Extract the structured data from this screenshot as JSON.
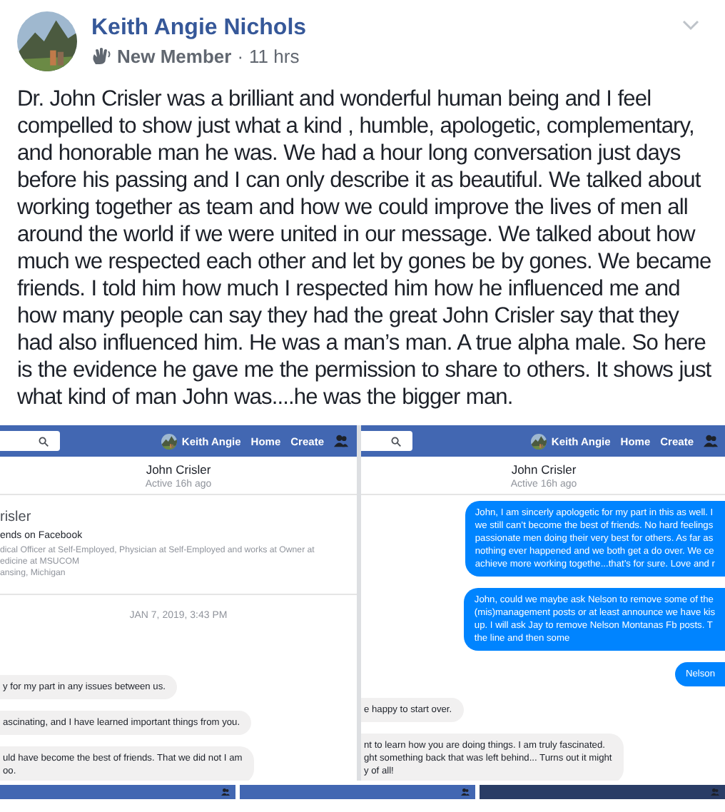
{
  "post": {
    "author": "Keith Angie Nichols",
    "badge": "New Member",
    "separator": "·",
    "time": "11 hrs",
    "body": "Dr. John Crisler was a brilliant and wonderful human being and I feel compelled to show just what a kind , humble, apologetic, complementary, and honorable man he was. We had a hour long conversation just days before his passing and I can only describe it as beautiful. We talked about working together as team and how we could improve the lives of men all around the world if we were united in our message. We talked about how much we respected each other and let by gones be by gones. We became friends. I told him how much I respected him how he influenced me and how many people can say they had the great John Crisler say that they had also influenced him. He was a man’s man. A true alpha male. So here is the evidence he gave me the permission to share to others. It shows just what kind of man John was....he was the bigger man."
  },
  "screenshots": [
    {
      "nav": {
        "user": "Keith Angie",
        "links": [
          "Home",
          "Create"
        ]
      },
      "chat": {
        "name": "John Crisler",
        "status": "Active 16h ago"
      },
      "items": [
        {
          "kind": "profile",
          "name": "risler",
          "subtitle": "ends on Facebook",
          "details": [
            "dical Officer at Self-Employed, Physician at Self-Employed and works at Owner at",
            "edicine at MSUCOM",
            "ansing, Michigan"
          ]
        },
        {
          "kind": "date",
          "text": "JAN 7, 2019, 3:43 PM"
        },
        {
          "kind": "spacer"
        },
        {
          "kind": "incoming",
          "lines": [
            "y for my part in any issues between us."
          ]
        },
        {
          "kind": "incoming",
          "lines": [
            "ascinating, and I have learned important things from you."
          ]
        },
        {
          "kind": "incoming",
          "lines": [
            "uld have become the best of friends. That we did not I am",
            "oo."
          ]
        }
      ]
    },
    {
      "nav": {
        "user": "Keith Angie",
        "links": [
          "Home",
          "Create"
        ]
      },
      "chat": {
        "name": "John Crisler",
        "status": "Active 16h ago"
      },
      "items": [
        {
          "kind": "outgoing",
          "lines": [
            "John, I am sincerly apologetic for my part in this as well. I",
            "we still can’t become the best of friends. No hard feelings",
            "passionate men doing their very best for others. As far as",
            "nothing ever happened and we both get a do over. We ce",
            "achieve more working togethe...that’s for sure. Love and r"
          ]
        },
        {
          "kind": "outgoing",
          "lines": [
            "John, could we maybe ask Nelson to remove some of the",
            "(mis)management posts or at least announce  we have kis",
            "up.  I will ask Jay to remove Nelson Montanas Fb posts. T",
            "the line and then some"
          ]
        },
        {
          "kind": "outgoing",
          "lines": [
            "Nelson"
          ]
        },
        {
          "kind": "incoming",
          "lines": [
            "e happy to start over."
          ]
        },
        {
          "kind": "incoming",
          "lines": [
            "nt to learn how you are doing things. I am truly fascinated.",
            "ght something back that was left behind... Turns out it might",
            "y of all!"
          ]
        }
      ]
    }
  ]
}
